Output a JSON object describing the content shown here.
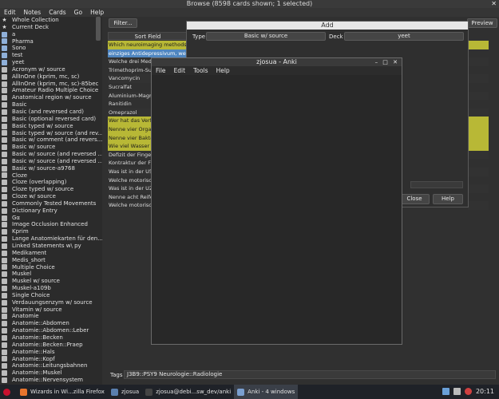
{
  "browse": {
    "title": "Browse (8598 cards shown; 1 selected)",
    "menu": [
      "Edit",
      "Notes",
      "Cards",
      "Go",
      "Help"
    ],
    "filter_label": "Filter...",
    "preview_label": "Preview",
    "column_header": "Sort Field",
    "sidebar": [
      {
        "label": "Whole Collection",
        "icon": "star-icon"
      },
      {
        "label": "Current Deck",
        "icon": "star-icon"
      },
      {
        "label": "a",
        "icon": "deck-icon"
      },
      {
        "label": "Pharma",
        "icon": "deck-icon"
      },
      {
        "label": "Sono",
        "icon": "deck-icon"
      },
      {
        "label": "test",
        "icon": "deck-icon"
      },
      {
        "label": "yeet",
        "icon": "deck-icon"
      },
      {
        "label": "Acronym w/ source",
        "icon": "notetype-icon"
      },
      {
        "label": "AllInOne (kprim, mc, sc)",
        "icon": "notetype-icon"
      },
      {
        "label": "AllInOne (kprim, mc, sc)-85bec",
        "icon": "notetype-icon"
      },
      {
        "label": "Amateur Radio Multiple Choice",
        "icon": "notetype-icon"
      },
      {
        "label": "Anatomical region w/ source",
        "icon": "notetype-icon"
      },
      {
        "label": "Basic",
        "icon": "notetype-icon"
      },
      {
        "label": "Basic (and reversed card)",
        "icon": "notetype-icon"
      },
      {
        "label": "Basic (optional reversed card)",
        "icon": "notetype-icon"
      },
      {
        "label": "Basic typed w/ source",
        "icon": "notetype-icon"
      },
      {
        "label": "Basic typed w/ source (and rev...",
        "icon": "notetype-icon"
      },
      {
        "label": "Basic w/ comment (and revers...",
        "icon": "notetype-icon"
      },
      {
        "label": "Basic w/ source",
        "icon": "notetype-icon"
      },
      {
        "label": "Basic w/ source (and reversed ...",
        "icon": "notetype-icon"
      },
      {
        "label": "Basic w/ source (and reversed ...",
        "icon": "notetype-icon"
      },
      {
        "label": "Basic w/ source-a9768",
        "icon": "notetype-icon"
      },
      {
        "label": "Cloze",
        "icon": "notetype-icon"
      },
      {
        "label": "Cloze (overlapping)",
        "icon": "notetype-icon"
      },
      {
        "label": "Cloze typed w/ source",
        "icon": "notetype-icon"
      },
      {
        "label": "Cloze w/ source",
        "icon": "notetype-icon"
      },
      {
        "label": "Commonly Tested Movements",
        "icon": "notetype-icon"
      },
      {
        "label": "Dictionary Entry",
        "icon": "notetype-icon"
      },
      {
        "label": "Gα",
        "icon": "notetype-icon"
      },
      {
        "label": "Image Occlusion Enhanced",
        "icon": "notetype-icon"
      },
      {
        "label": "Kprim",
        "icon": "notetype-icon"
      },
      {
        "label": "Lange Anatomiekarten für den...",
        "icon": "notetype-icon"
      },
      {
        "label": "Linked Statements w\\ py",
        "icon": "notetype-icon"
      },
      {
        "label": "Medikament",
        "icon": "notetype-icon"
      },
      {
        "label": "Medis_short",
        "icon": "notetype-icon"
      },
      {
        "label": "Multiple Choice",
        "icon": "notetype-icon"
      },
      {
        "label": "Muskel",
        "icon": "notetype-icon"
      },
      {
        "label": "Muskel w/ source",
        "icon": "notetype-icon"
      },
      {
        "label": "Muskel-a109b",
        "icon": "notetype-icon"
      },
      {
        "label": "Single Choice",
        "icon": "notetype-icon"
      },
      {
        "label": "Verdauungsenzym w/ source",
        "icon": "notetype-icon"
      },
      {
        "label": "Vitamin w/ source",
        "icon": "notetype-icon"
      },
      {
        "label": "Anatomie",
        "icon": "tag-icon"
      },
      {
        "label": "Anatomie::Abdomen",
        "icon": "tag-icon"
      },
      {
        "label": "Anatomie::Abdomen::Leber",
        "icon": "tag-icon"
      },
      {
        "label": "Anatomie::Becken",
        "icon": "tag-icon"
      },
      {
        "label": "Anatomie::Becken::Praep",
        "icon": "tag-icon"
      },
      {
        "label": "Anatomie::Hals",
        "icon": "tag-icon"
      },
      {
        "label": "Anatomie::Kopf",
        "icon": "tag-icon"
      },
      {
        "label": "Anatomie::Leitungsbahnen",
        "icon": "tag-icon"
      },
      {
        "label": "Anatomie::Muskel",
        "icon": "tag-icon"
      },
      {
        "label": "Anatomie::Nervensystem",
        "icon": "tag-icon"
      }
    ],
    "rows": [
      {
        "text": "Which neuroimaging methods ar",
        "style": "yellow"
      },
      {
        "text": "einziges Antidepressivum, welch",
        "style": "blue"
      },
      {
        "text": "Welche drei Medik",
        "style": "alt"
      },
      {
        "text": "Trimethoprim-Sulf",
        "style": "plain"
      },
      {
        "text": "Vancomycin",
        "style": "alt"
      },
      {
        "text": "Sucralfat",
        "style": "plain"
      },
      {
        "text": "Aluminium-Magne",
        "style": "alt"
      },
      {
        "text": "Ranitidin",
        "style": "plain"
      },
      {
        "text": "Omeprazol",
        "style": "alt"
      },
      {
        "text": "Wer hat das Verfa",
        "style": "yellow"
      },
      {
        "text": "Nenne vier Organ",
        "style": "yellow"
      },
      {
        "text": "Nenne vier Bakter",
        "style": "yellow"
      },
      {
        "text": "Wie viel Wasser w",
        "style": "yellow"
      },
      {
        "text": "Defizit der Fingert",
        "style": "alt"
      },
      {
        "text": "Kontraktur der Fin",
        "style": "plain"
      },
      {
        "text": "Was ist in der U5 t",
        "style": "alt"
      },
      {
        "text": "Welche motorisch",
        "style": "plain"
      },
      {
        "text": "Was ist in der U2 t",
        "style": "alt"
      },
      {
        "text": "Nenne acht Reifez",
        "style": "plain"
      },
      {
        "text": "Welche motorisch",
        "style": "alt"
      }
    ],
    "tags_label": "Tags",
    "tags_value": "J3B9::PSY9 Neurologie::Radiologie"
  },
  "add": {
    "title": "Add",
    "type_label": "Type",
    "type_value": "Basic w/ source",
    "deck_label": "Deck",
    "deck_value": "yeet",
    "close_label": "Close",
    "help_label": "Help"
  },
  "anki": {
    "title": "zjosua - Anki",
    "menu": [
      "File",
      "Edit",
      "Tools",
      "Help"
    ]
  },
  "taskbar": {
    "items": [
      {
        "label": "Wizards in Wi...zilla Firefox",
        "color": "#e8742d"
      },
      {
        "label": "zjosua",
        "color": "#5a7fae"
      },
      {
        "label": "zjosua@debi...sw_dev/anki",
        "color": "#444"
      },
      {
        "label": "Anki - 4 windows",
        "color": "#7a9fd0"
      }
    ],
    "clock": "20:11"
  }
}
